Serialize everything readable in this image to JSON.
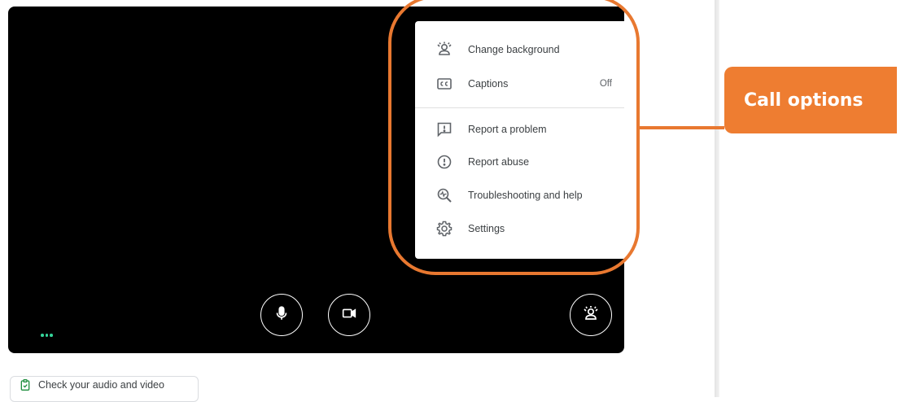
{
  "menu": {
    "items": [
      {
        "id": "change-background",
        "label": "Change background",
        "icon": "background-person-icon",
        "value": ""
      },
      {
        "id": "captions",
        "label": "Captions",
        "icon": "cc-icon",
        "value": "Off"
      },
      {
        "id": "report-problem",
        "label": "Report a problem",
        "icon": "report-problem-icon",
        "value": ""
      },
      {
        "id": "report-abuse",
        "label": "Report abuse",
        "icon": "report-abuse-icon",
        "value": ""
      },
      {
        "id": "troubleshooting",
        "label": "Troubleshooting and help",
        "icon": "troubleshoot-icon",
        "value": ""
      },
      {
        "id": "settings",
        "label": "Settings",
        "icon": "gear-icon",
        "value": ""
      }
    ]
  },
  "controls": {
    "mic_icon": "microphone-icon",
    "camera_icon": "camera-icon",
    "effects_icon": "background-person-icon",
    "more_icon": "more-options-icon"
  },
  "check_chip": {
    "label": "Check your audio and video",
    "icon": "clipboard-check-icon"
  },
  "callout": {
    "label": "Call options",
    "color": "#ee7d31"
  },
  "colors": {
    "video_bg": "#000000",
    "menu_text": "#3c4043",
    "accent_green": "#34d399"
  }
}
